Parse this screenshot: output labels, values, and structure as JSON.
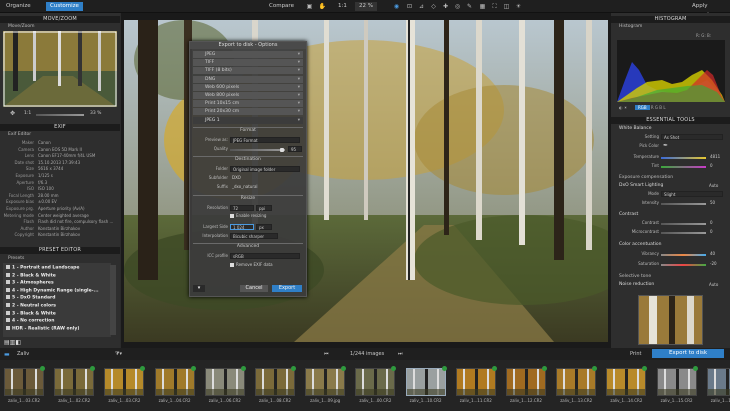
{
  "topbar": {
    "organize": "Organize",
    "customize": "Customize",
    "compare": "Compare",
    "zoom_value": "22 %",
    "apply_preset": "Apply preset",
    "rotate_value": "1:1"
  },
  "left_panel": {
    "move_zoom_title": "MOVE/ZOOM",
    "move_zoom_sub": "Move/Zoom",
    "zoom_1to1": "1:1",
    "zoom_pct": "33 %",
    "exif_title": "EXIF",
    "exif_sub": "Exif Editor",
    "exif": [
      {
        "k": "Maker",
        "v": "Canon"
      },
      {
        "k": "Camera",
        "v": "Canon EOS 5D Mark II"
      },
      {
        "k": "Lens",
        "v": "Canon EF17-40mm f/4L USM"
      },
      {
        "k": "Date shot",
        "v": "15.10.2013 17:39:43"
      },
      {
        "k": "Size",
        "v": "5616 x 3744"
      },
      {
        "k": "Exposure",
        "v": "1/125 s"
      },
      {
        "k": "Aperture",
        "v": "f/6.3"
      },
      {
        "k": "ISO",
        "v": "ISO 100"
      },
      {
        "k": "Focal Length",
        "v": "28.00 mm"
      },
      {
        "k": "Exposure bias",
        "v": "±0.00 EV"
      },
      {
        "k": "Exposure prg.",
        "v": "Aperture priority (Av/A)"
      },
      {
        "k": "Metering mode",
        "v": "Center weighted average"
      },
      {
        "k": "Flash",
        "v": "Flash did not fire, compulsory flash ..."
      },
      {
        "k": "Author",
        "v": "Konstantin Birzhakov"
      },
      {
        "k": "Copyright",
        "v": "Konstantin Birzhakov"
      }
    ],
    "preset_title": "PRESET EDITOR",
    "presets_sub": "Presets",
    "presets": [
      "1 - Portrait and Landscape",
      "2 - Black & White",
      "3 - Atmospheres",
      "4 - High Dynamic Range (single-...",
      "5 - DxO Standard",
      "2 - Neutral colors",
      "3 - Black & White",
      "4 - No correction",
      "HDR - Realistic (RAW only)"
    ]
  },
  "dialog": {
    "title": "Export to disk - Options",
    "formats": [
      "JPEG",
      "TIFF",
      "TIFF (8 bits)",
      "DNG",
      "Web 600 pixels",
      "Web 800 pixels",
      "Print 10x15 cm",
      "Print 20x30 cm",
      "JPEG 1"
    ],
    "format_section": "Format",
    "preview_as_label": "Preview as:",
    "preview_as_value": "JPEG Format",
    "quality_label": "Quality",
    "quality_value": "95",
    "destination_section": "Destination",
    "folder_label": "Folder",
    "folder_value": "Original image folder",
    "subfolder_label": "Subfolder",
    "subfolder_value": "DXO",
    "suffix_label": "Suffix",
    "suffix_value": "_dxo_natural",
    "resize_section": "Resize",
    "resolution_label": "Resolution",
    "resolution_value": "72",
    "resolution_unit": "ppi",
    "enable_resizing": "Enable resizing",
    "largest_side_label": "Largest Side",
    "largest_side_value": "1 024",
    "largest_side_unit": "px",
    "interpolation_label": "Interpolation",
    "interpolation_value": "Bicubic sharper",
    "advanced_section": "Advanced",
    "icc_label": "ICC profile",
    "icc_value": "sRGB",
    "remove_exif": "Remove EXIF data",
    "cancel": "Cancel",
    "export": "Export"
  },
  "right_panel": {
    "histogram_title": "HISTOGRAM",
    "histogram_sub": "Histogram",
    "rgb_label": "R: G: B:",
    "essential_title": "ESSENTIAL TOOLS",
    "white_balance": "White Balance",
    "wb_setting_label": "Setting",
    "wb_setting_value": "As Shot",
    "pick_color": "Pick Color",
    "temperature_label": "Temperature",
    "temperature_value": "4811",
    "tint_label": "Tint",
    "tint_value": "0",
    "exposure_comp": "Exposure compensation",
    "smart_lighting": "DxO Smart Lighting",
    "sl_auto": "Auto",
    "sl_mode_label": "Mode",
    "sl_mode_value": "Slight",
    "sl_intensity_label": "Intensity",
    "sl_intensity_value": "50",
    "contrast": "Contrast",
    "contrast_label": "Contrast",
    "contrast_value": "0",
    "microcontrast_label": "Microcontrast",
    "microcontrast_value": "0",
    "color_accent": "Color accentuation",
    "vibrancy_label": "Vibrancy",
    "vibrancy_value": "40",
    "saturation_label": "Saturation",
    "saturation_value": "-20",
    "selective_tone": "Selective tone",
    "noise_reduction": "Noise reduction",
    "nr_auto": "Auto"
  },
  "filmstrip": {
    "folder": "Zaliv",
    "count": "1/244 images",
    "print": "Print",
    "export_to_disk": "Export to disk",
    "thumbs": [
      "zaliv_1...03.CR2",
      "zaliv_1...02.CR2",
      "zaliv_1...03.CR2",
      "zaliv_1...04.CR2",
      "zaliv_1...06.CR2",
      "zaliv_1...08.CR2",
      "zaliv_1...09.jpg",
      "zaliv_1...00.CR2",
      "zaliv_1...10.CR2",
      "zaliv_1...11.CR2",
      "zaliv_1...12.CR2",
      "zaliv_1...13.CR2",
      "zaliv_1...14.CR2",
      "zaliv_1...15.CR2",
      "zaliv_1...16.CR2"
    ]
  },
  "colors": {
    "accent": "#2f7fc7",
    "panel": "#2e2e2e",
    "header": "#1c1c1c"
  }
}
